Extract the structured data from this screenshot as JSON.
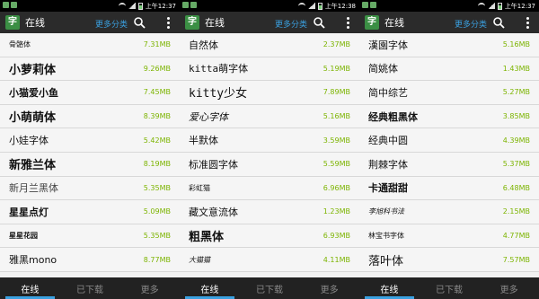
{
  "screens": [
    {
      "status_time": "上午12:37",
      "title": "在线",
      "more_categories": "更多分类",
      "items": [
        {
          "name": "骨骼体",
          "size": "7.31MB"
        },
        {
          "name": "小萝莉体",
          "size": "9.26MB"
        },
        {
          "name": "小猫爱小鱼",
          "size": "7.45MB"
        },
        {
          "name": "小萌萌体",
          "size": "8.39MB"
        },
        {
          "name": "小娃字体",
          "size": "5.42MB"
        },
        {
          "name": "新雅兰体",
          "size": "8.19MB"
        },
        {
          "name": "新月兰黑体",
          "size": "5.35MB"
        },
        {
          "name": "星星点灯",
          "size": "5.09MB"
        },
        {
          "name": "星星花园",
          "size": "5.35MB"
        },
        {
          "name": "雅黑mono",
          "size": "8.77MB"
        }
      ],
      "tabs": [
        "在线",
        "已下载",
        "更多"
      ]
    },
    {
      "status_time": "上午12:38",
      "title": "在线",
      "more_categories": "更多分类",
      "items": [
        {
          "name": "自然体",
          "size": "2.37MB"
        },
        {
          "name": "kitta萌字体",
          "size": "5.19MB"
        },
        {
          "name": "kitty少女",
          "size": "7.89MB"
        },
        {
          "name": "爱心字体",
          "size": "5.16MB"
        },
        {
          "name": "半默体",
          "size": "3.59MB"
        },
        {
          "name": "标准圆字体",
          "size": "5.59MB"
        },
        {
          "name": "彩虹猫",
          "size": "6.96MB"
        },
        {
          "name": "藏文意流体",
          "size": "1.23MB"
        },
        {
          "name": "粗黑体",
          "size": "6.93MB"
        },
        {
          "name": "大猫猫",
          "size": "4.11MB"
        }
      ],
      "tabs": [
        "在线",
        "已下载",
        "更多"
      ]
    },
    {
      "status_time": "上午12:37",
      "title": "在线",
      "more_categories": "更多分类",
      "items": [
        {
          "name": "漢園字体",
          "size": "5.16MB"
        },
        {
          "name": "简姚体",
          "size": "1.43MB"
        },
        {
          "name": "简中综艺",
          "size": "5.27MB"
        },
        {
          "name": "经典粗黑体",
          "size": "3.85MB"
        },
        {
          "name": "经典中圆",
          "size": "4.39MB"
        },
        {
          "name": "荆棘字体",
          "size": "5.37MB"
        },
        {
          "name": "卡通甜甜",
          "size": "6.48MB"
        },
        {
          "name": "李旭科书法",
          "size": "2.15MB"
        },
        {
          "name": "林宝书字体",
          "size": "4.77MB"
        },
        {
          "name": "落叶体",
          "size": "7.57MB"
        }
      ],
      "tabs": [
        "在线",
        "已下载",
        "更多"
      ]
    }
  ]
}
